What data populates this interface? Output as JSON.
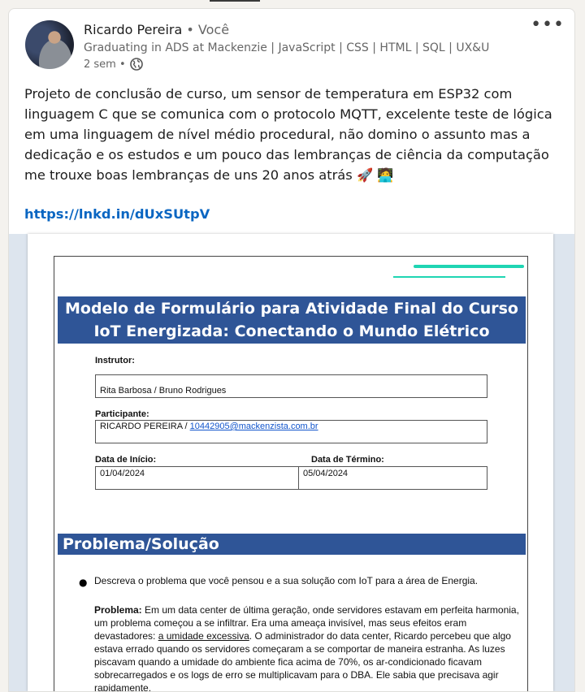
{
  "author": {
    "name": "Ricardo Pereira",
    "relation": "• Você",
    "headline": "Graduating in ADS at Mackenzie | JavaScript | CSS | HTML | SQL | UX&UI…",
    "time": "2 sem •"
  },
  "post": {
    "text": "Projeto de conclusão de curso, um sensor de temperatura em ESP32 com linguagem C que se comunica com o protocolo MQTT, excelente teste de lógica em uma linguagem de nível médio procedural, não domino o assunto mas a dedicação e os estudos e um pouco das lembranças de ciência da computação me trouxe boas lembranças de uns 20 anos atrás 🚀 🧑‍💻",
    "link": "https://lnkd.in/dUxSUtpV"
  },
  "more_label": "•••",
  "document": {
    "title_line1": "Modelo de Formulário para Atividade Final do Curso",
    "title_line2": "IoT Energizada: Conectando o Mundo Elétrico",
    "instrutor_label": "Instrutor:",
    "instrutor_value": "Rita Barbosa / Bruno Rodrigues",
    "participante_label": "Participante:",
    "participante_name": "RICARDO PEREIRA / ",
    "participante_email": "10442905@mackenzista.com.br",
    "inicio_label": "Data de Início:",
    "inicio_value": "01/04/2024",
    "termino_label": "Data de Término:",
    "termino_value": "05/04/2024",
    "section_title": "Problema/Solução",
    "bullet": "Descreva o problema que você pensou e a sua solução com IoT para a área de Energia.",
    "problema_label": "Problema:",
    "problema_part1": " Em um data center de última geração, onde servidores estavam em perfeita harmonia, um problema começou a se infiltrar. Era uma ameaça invisível, mas seus efeitos eram devastadores: ",
    "problema_underlined": "a umidade excessiva",
    "problema_part2": ". O administrador do data center, Ricardo percebeu que algo estava errado quando os servidores começaram a se comportar de maneira estranha. As luzes piscavam quando a umidade do ambiente fica acima de 70%, os ar-condicionado ficavam sobrecarregados e os logs de erro se multiplicavam para o DBA. Ele sabia que precisava agir rapidamente."
  }
}
